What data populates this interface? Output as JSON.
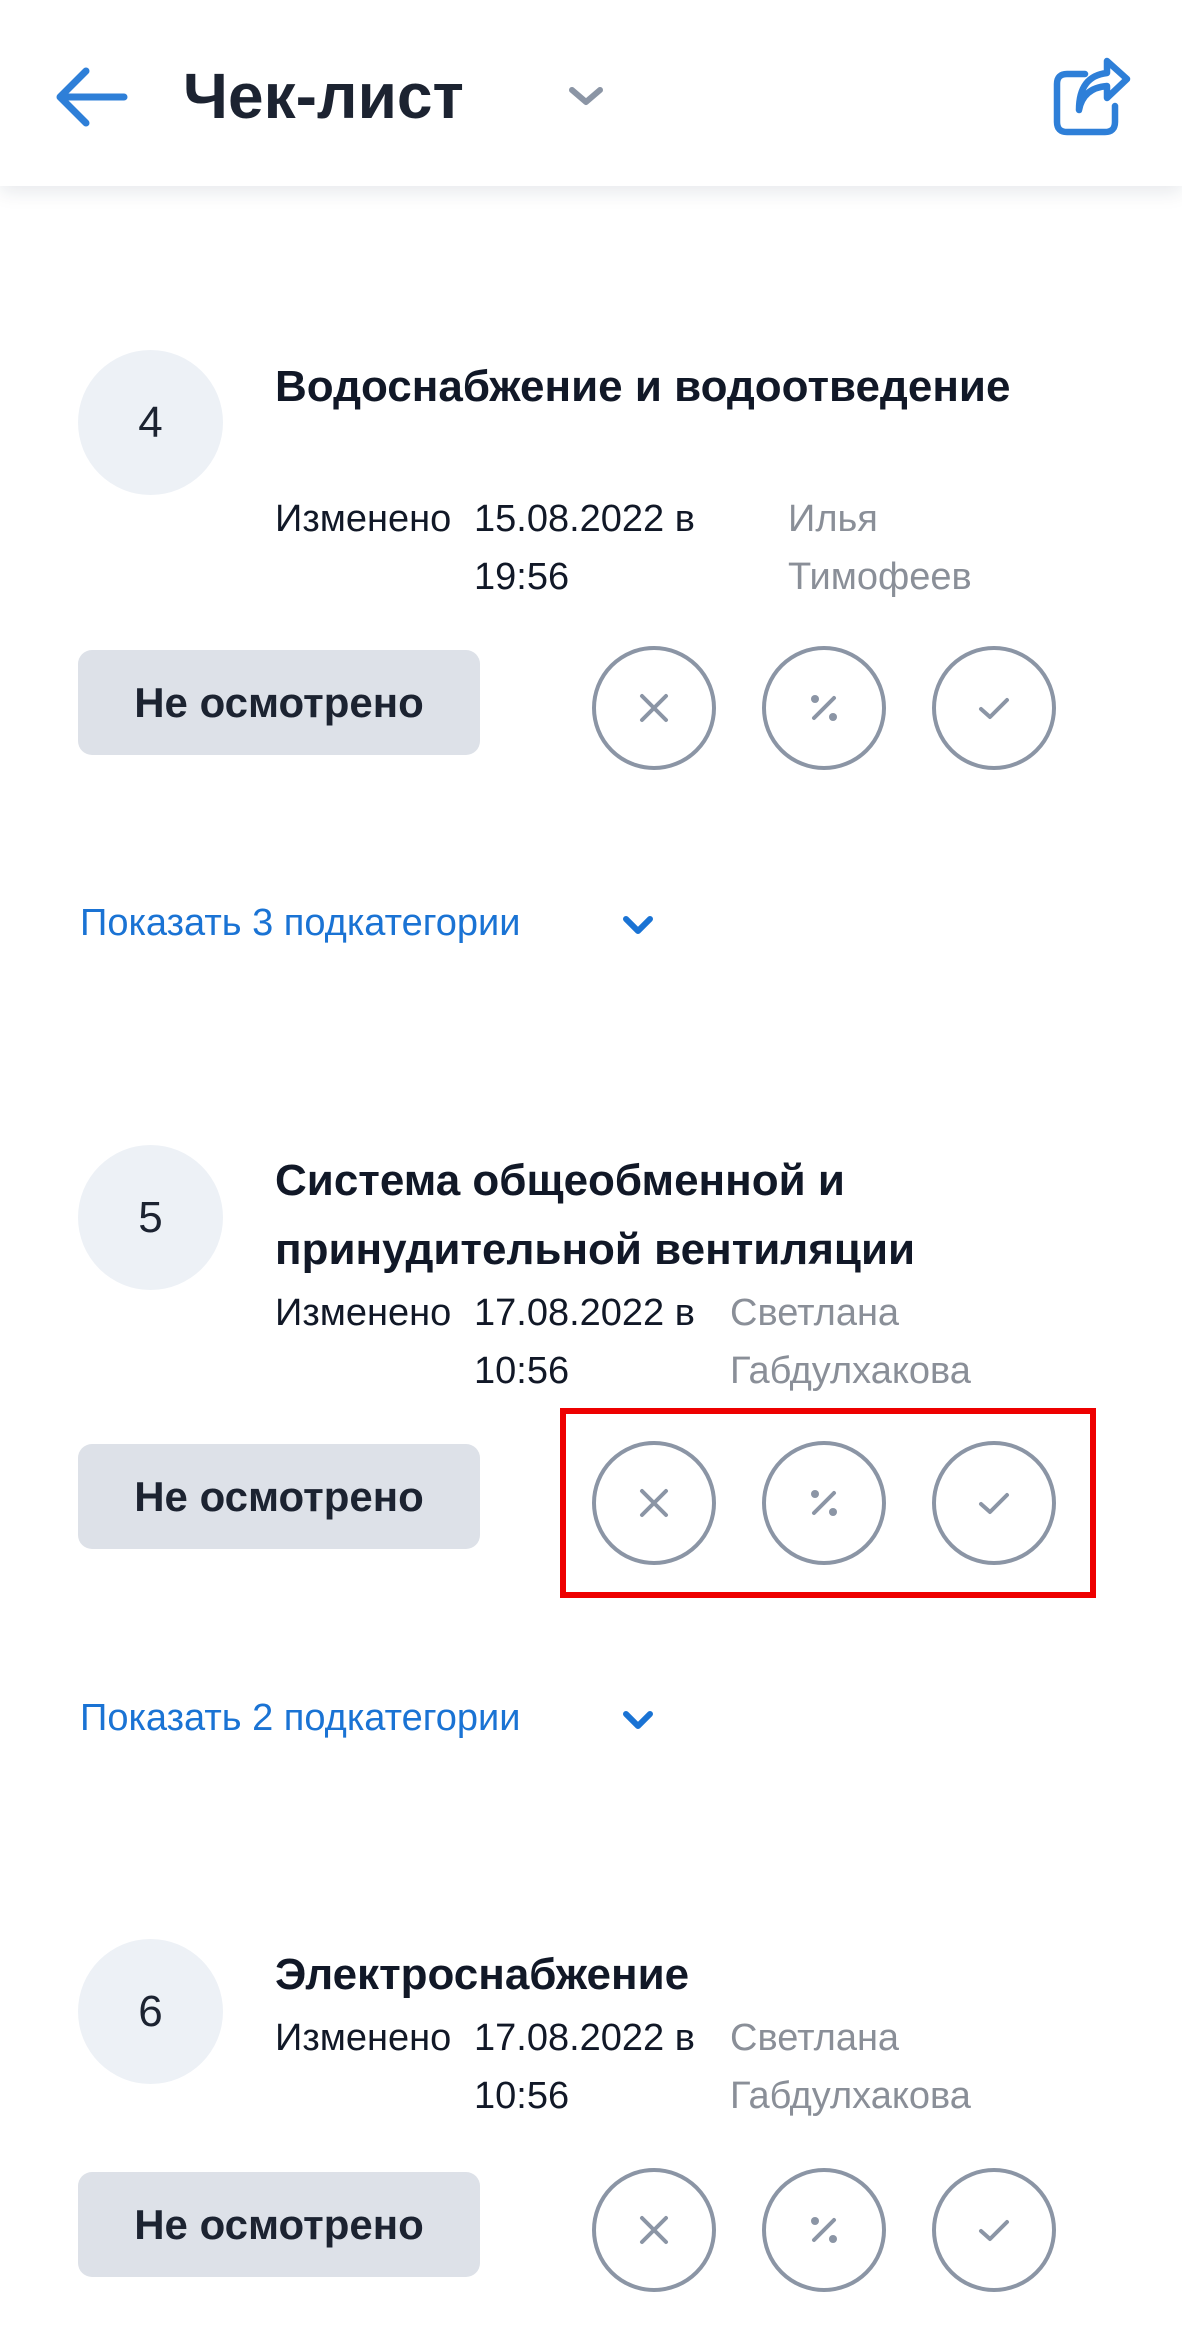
{
  "header": {
    "title": "Чек-лист",
    "back_icon": "arrow-left-icon",
    "dropdown_icon": "chevron-down-icon",
    "share_icon": "share-icon",
    "accent_color": "#2e7fd8"
  },
  "categories": [
    {
      "number": "4",
      "title": "Водоснабжение и водоотведение",
      "changed_label": "Изменено",
      "date": "15.08.2022 в",
      "time": "19:56",
      "user_first": "Илья",
      "user_last": "Тимофеев",
      "status": "Не осмотрено",
      "show_sub": "Показать 3 подкатегории"
    },
    {
      "number": "5",
      "title": "Система общеобменной и принудительной вентиляции",
      "changed_label": "Изменено",
      "date": "17.08.2022 в",
      "time": "10:56",
      "user_first": "Светлана",
      "user_last": "Габдулхакова",
      "status": "Не осмотрено",
      "show_sub": "Показать 2 подкатегории"
    },
    {
      "number": "6",
      "title": "Электроснабжение",
      "changed_label": "Изменено",
      "date": "17.08.2022 в",
      "time": "10:56",
      "user_first": "Светлана",
      "user_last": "Габдулхакова",
      "status": "Не осмотрено"
    }
  ],
  "rating_icons": [
    "close-icon",
    "percent-icon",
    "check-icon"
  ]
}
